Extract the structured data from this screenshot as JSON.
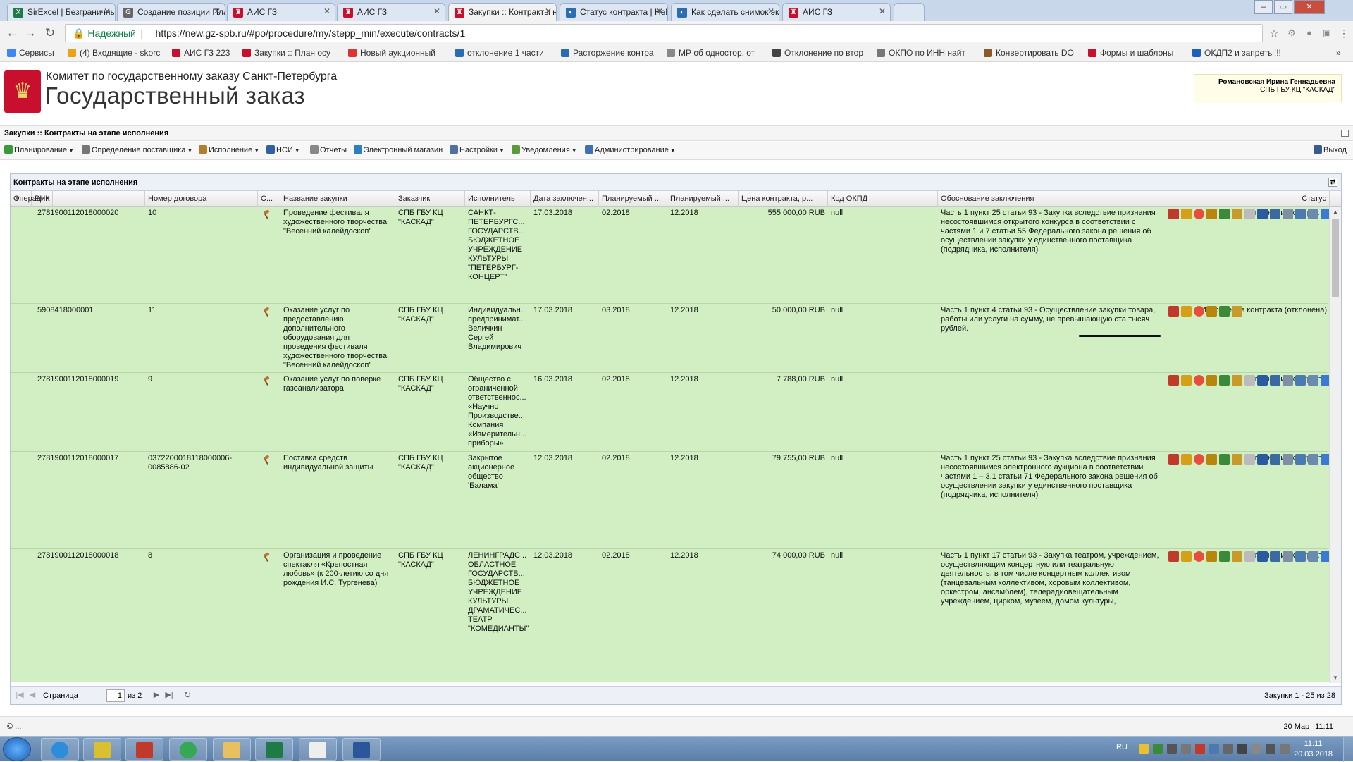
{
  "browser": {
    "tabs": [
      {
        "title": "SirExcel | Безграничные",
        "color": "#1e7b45",
        "glyph": "X"
      },
      {
        "title": "Создание позиции Пла",
        "color": "#666666",
        "glyph": "G"
      },
      {
        "title": "АИС ГЗ",
        "color": "#c8102e",
        "glyph": "♜"
      },
      {
        "title": "АИС ГЗ",
        "color": "#c8102e",
        "glyph": "♜"
      },
      {
        "title": "Закупки :: Контракты на",
        "color": "#c8102e",
        "glyph": "♜"
      },
      {
        "title": "Статус контракта | Help",
        "color": "#2a6db3",
        "glyph": "◐"
      },
      {
        "title": "Как сделать снимок экр",
        "color": "#2a6db3",
        "glyph": "◐"
      },
      {
        "title": "АИС ГЗ",
        "color": "#c8102e",
        "glyph": "♜"
      }
    ],
    "secure_label": "Надежный",
    "url": "https://new.gz-spb.ru/#po/procedure/my/stepp_min/execute/contracts/1",
    "bookmarks": [
      {
        "label": "Сервисы",
        "color": "#4285f4"
      },
      {
        "label": "(4) Входящие - skorc",
        "color": "#e8a317"
      },
      {
        "label": "АИС ГЗ 223",
        "color": "#c8102e"
      },
      {
        "label": "Закупки :: План осу",
        "color": "#c8102e"
      },
      {
        "label": "Новый аукционный",
        "color": "#d33"
      },
      {
        "label": "отклонение 1 части",
        "color": "#2a6db3"
      },
      {
        "label": "Расторжение контра",
        "color": "#2a6db3"
      },
      {
        "label": "МР об одностор. от",
        "color": "#888888"
      },
      {
        "label": "Отклонение по втор",
        "color": "#444444"
      },
      {
        "label": "ОКПО по ИНН найт",
        "color": "#777777"
      },
      {
        "label": "Конвертировать DO",
        "color": "#8a5a2b"
      },
      {
        "label": "Формы и шаблоны",
        "color": "#c8102e"
      },
      {
        "label": "ОКДП2 и запреты!!!",
        "color": "#1b5fbf"
      }
    ]
  },
  "header": {
    "org_line1": "Комитет по государственному заказу Санкт-Петербурга",
    "org_line2": "Государственный заказ",
    "user_name": "Романовская Ирина Геннадьевна",
    "user_org": "СПБ ГБУ КЦ \"КАСКАД\""
  },
  "section_title": "Закупки :: Контракты на этапе исполнения",
  "menu": [
    {
      "label": "Планирование",
      "color": "#3a9a3a",
      "dropdown": true
    },
    {
      "label": "Определение поставщика",
      "color": "#777777",
      "dropdown": true
    },
    {
      "label": "Исполнение",
      "color": "#b08030",
      "dropdown": true
    },
    {
      "label": "НСИ",
      "color": "#3060a0",
      "dropdown": true
    },
    {
      "label": "Отчеты",
      "color": "#888888",
      "dropdown": false
    },
    {
      "label": "Электронный магазин",
      "color": "#2a80c0",
      "dropdown": false
    },
    {
      "label": "Настройки",
      "color": "#5070a0",
      "dropdown": true
    },
    {
      "label": "Уведомления",
      "color": "#5a9a3a",
      "dropdown": true
    },
    {
      "label": "Администрирование",
      "color": "#4070b0",
      "dropdown": true
    }
  ],
  "exit_label": "Выход",
  "grid": {
    "title": "Контракты на этапе исполнения",
    "columns": [
      "РНК",
      "Номер договора",
      "С...",
      "Название закупки",
      "Заказчик",
      "Исполнитель",
      "Дата заключен...",
      "Планируемый ...",
      "Планируемый ...",
      "Цена контракта, р...",
      "Код ОКПД",
      "Обоснование заключения",
      "Статус",
      "Операции"
    ],
    "rows": [
      {
        "rnk": "2781900112018000020",
        "num": "10",
        "name": "Проведение фестиваля художественного творчества \"Весенний калейдоскоп\"",
        "customer": "СПБ ГБУ КЦ \"КАСКАД\"",
        "executor": "САНКТ-ПЕТЕРБУРГС... ГОСУДАРСТВ... БЮДЖЕТНОЕ УЧРЕЖДЕНИЕ КУЛЬТУРЫ \"ПЕТЕРБУРГ-КОНЦЕРТ\"",
        "date": "17.03.2018",
        "plan1": "02.2018",
        "plan2": "12.2018",
        "price": "555 000,00 RUB",
        "okpd": "null",
        "basis": "Часть 1 пункт 25 статьи 93 - Закупка вследствие признания несостоявшимся открытого конкурса в соответствии с частями 1 и 7 статьи 55 Федерального закона решения об осуществлении закупки у единственного поставщика (подрядчика, исполнителя)",
        "status": "Исполнение контракта",
        "ops": 13
      },
      {
        "rnk": "5908418000001",
        "num": "11",
        "name": "Оказание услуг по предоставлению дополнительного оборудования для проведения фестиваля художественного творчества \"Весенний калейдоскоп\"",
        "customer": "СПБ ГБУ КЦ \"КАСКАД\"",
        "executor": "Индивидуальн... предпринимат... Величкин Сергей Владимирович",
        "date": "17.03.2018",
        "plan1": "03.2018",
        "plan2": "12.2018",
        "price": "50 000,00 RUB",
        "okpd": "null",
        "basis": "Часть 1 пункт 4 статьи 93 - Осуществление закупки товара, работы или услуги на сумму, не превышающую ста тысяч рублей.",
        "status": "Исполнение контракта (отклонена)",
        "ops": 6
      },
      {
        "rnk": "2781900112018000019",
        "num": "9",
        "name": "Оказание услуг по поверке газоанализатора",
        "customer": "СПБ ГБУ КЦ \"КАСКАД\"",
        "executor": "Общество с ограниченной ответственнос... «Научно Производстве... Компания «Измерительн... приборы»",
        "date": "16.03.2018",
        "plan1": "02.2018",
        "plan2": "12.2018",
        "price": "7 788,00 RUB",
        "okpd": "null",
        "basis": "",
        "status": "Исполнение контракта",
        "ops": 13
      },
      {
        "rnk": "2781900112018000017",
        "num": "0372200018118000006-0085886-02",
        "name": "Поставка средств индивидуальной защиты",
        "customer": "СПБ ГБУ КЦ \"КАСКАД\"",
        "executor": "Закрытое акционерное общество 'Балама'",
        "date": "12.03.2018",
        "plan1": "02.2018",
        "plan2": "12.2018",
        "price": "79 755,00 RUB",
        "okpd": "null",
        "basis": "Часть 1 пункт 25 статьи 93 - Закупка вследствие признания несостоявшимся электронного аукциона в соответствии частями 1 – 3.1 статьи 71 Федерального закона решения об осуществлении закупки у единственного поставщика (подрядчика, исполнителя)",
        "status": "Исполнение контракта",
        "ops": 13
      },
      {
        "rnk": "2781900112018000018",
        "num": "8",
        "name": "Организация и проведение спектакля «Крепостная любовь» (к 200-летию со дня рождения И.С. Тургенева)",
        "customer": "СПБ ГБУ КЦ \"КАСКАД\"",
        "executor": "ЛЕНИНГРАДС... ОБЛАСТНОЕ ГОСУДАРСТВ... БЮДЖЕТНОЕ УЧРЕЖДЕНИЕ КУЛЬТУРЫ ДРАМАТИЧЕС... ТЕАТР \"КОМЕДИАНТЫ\"",
        "date": "12.03.2018",
        "plan1": "02.2018",
        "plan2": "12.2018",
        "price": "74 000,00 RUB",
        "okpd": "null",
        "basis": "Часть 1 пункт 17 статьи 93 - Закупка театром, учреждением, осуществляющим концертную или театральную деятельность, в том числе концертным коллективом (танцевальным коллективом, хоровым коллективом, оркестром, ансамблем), телерадиовещательным учреждением, цирком, музеем, домом культуры,",
        "status": "Исполнение контракта",
        "ops": 13
      }
    ],
    "op_colors": [
      "#c0392b",
      "#d4a017",
      "#e74c3c",
      "#b8860b",
      "#3a8a3a",
      "#c89a2a",
      "#bbbbbb",
      "#2a5aa0",
      "#3a6aa0",
      "#7f8fa6",
      "#4a7ab0",
      "#6a8ab0",
      "#3a7ad0"
    ],
    "pager": {
      "page_label": "Страница",
      "page_value": "1",
      "of_label": "из 2",
      "summary": "Закупки 1 - 25 из 28"
    }
  },
  "statusbar": {
    "left": "© ...",
    "right": "20 Март 11:11"
  },
  "taskbar": {
    "lang": "RU",
    "time": "11:11",
    "date": "20.03.2018",
    "apps": [
      {
        "name": "ie",
        "color": "#2e8ddb"
      },
      {
        "name": "app2",
        "color": "#d8c030"
      },
      {
        "name": "app3",
        "color": "#c0392b"
      },
      {
        "name": "chrome",
        "color": "#34a853"
      },
      {
        "name": "explorer",
        "color": "#e8c060"
      },
      {
        "name": "excel",
        "color": "#1e7b45"
      },
      {
        "name": "doc",
        "color": "#eeeeee"
      },
      {
        "name": "word",
        "color": "#2b579a"
      }
    ]
  }
}
